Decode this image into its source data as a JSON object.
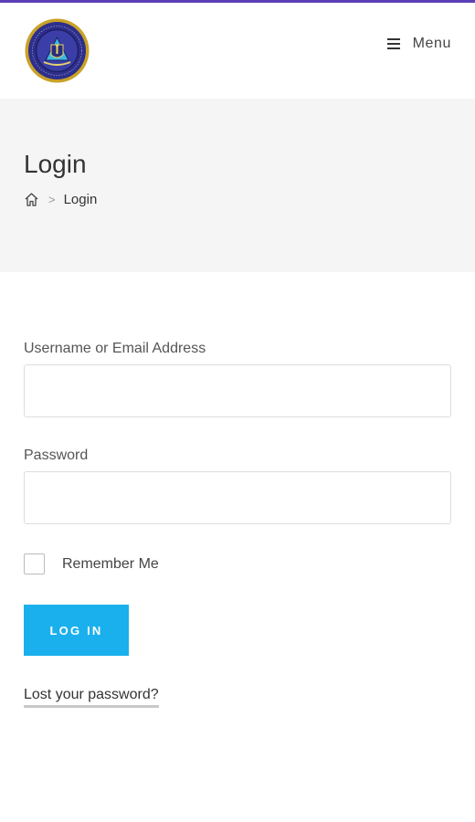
{
  "header": {
    "menu_label": "Menu",
    "accent_color": "#5b3fb6",
    "logo_icon": "school-crest-logo",
    "menu_icon": "hamburger-icon"
  },
  "page_header": {
    "title": "Login",
    "breadcrumb": {
      "home_icon": "home-icon",
      "separator": ">",
      "current": "Login"
    }
  },
  "login_form": {
    "username_label": "Username or Email Address",
    "username_value": "",
    "password_label": "Password",
    "password_value": "",
    "remember_label": "Remember Me",
    "remember_checked": false,
    "submit_label": "LOG IN",
    "submit_color": "#1ab0ed",
    "lost_password_label": "Lost your password?"
  }
}
